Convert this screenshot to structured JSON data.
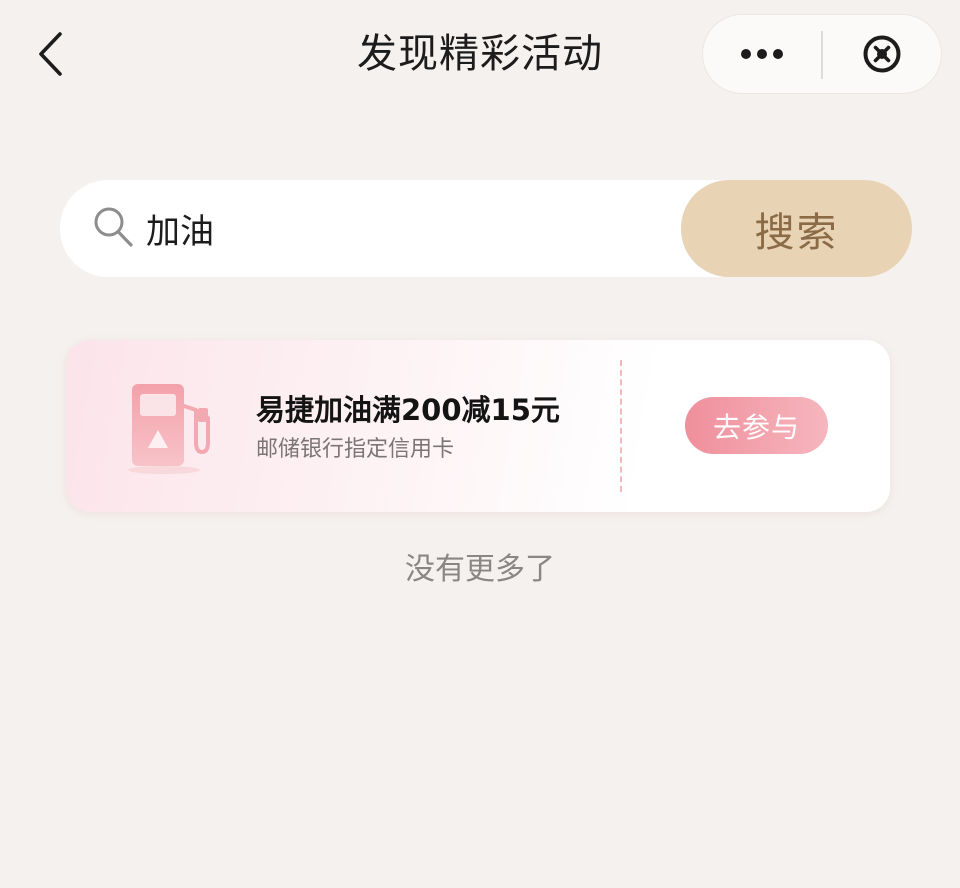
{
  "nav": {
    "title": "发现精彩活动",
    "back_icon": "chevron-left-icon",
    "more_icon": "more-dots-icon",
    "close_icon": "close-circle-icon"
  },
  "search": {
    "value": "加油",
    "placeholder": "",
    "button_label": "搜索",
    "icon": "search-icon"
  },
  "activities": [
    {
      "icon": "gas-pump-icon",
      "title": "易捷加油满200减15元",
      "subtitle": "邮储银行指定信用卡",
      "button_label": "去参与"
    }
  ],
  "list_end_text": "没有更多了",
  "colors": {
    "background": "#f5f1ee",
    "search_button": "#e8d3b5",
    "search_button_text": "#8b6b45",
    "accent_pink": "#ef8f9c"
  }
}
